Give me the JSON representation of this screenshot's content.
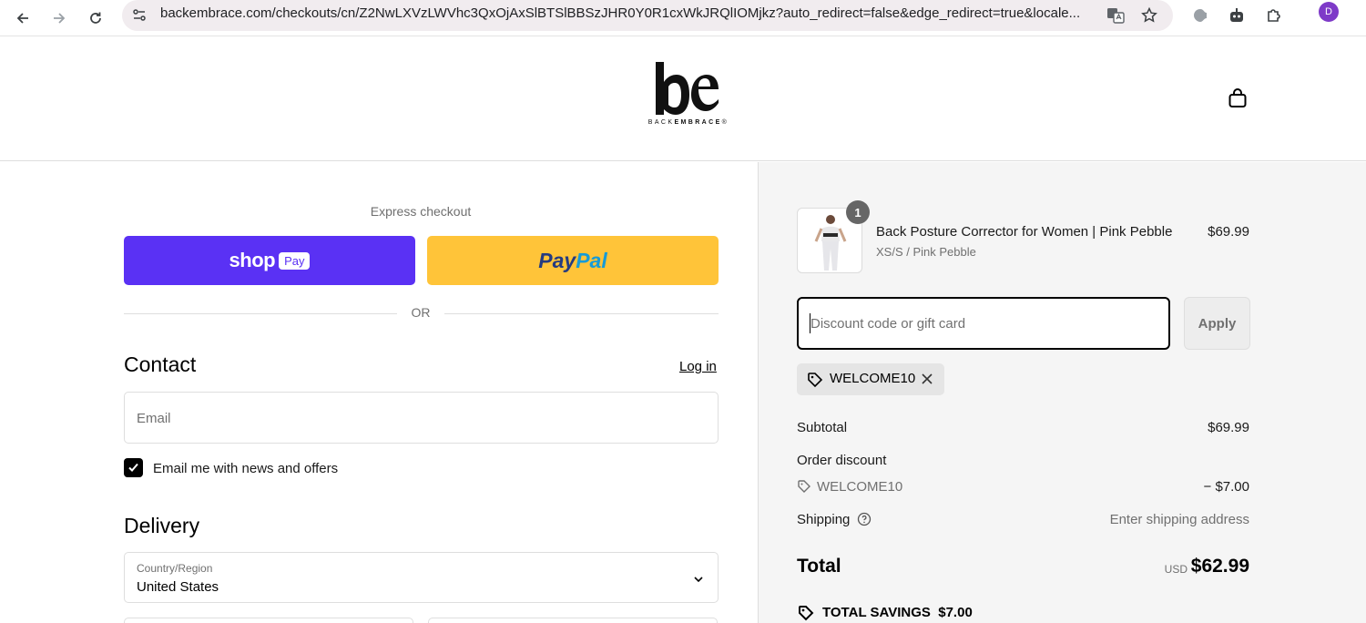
{
  "browser": {
    "url": "backembrace.com/checkouts/cn/Z2NwLXVzLWVhc3QxOjAxSlBTSlBBSzJHR0Y0R1cxWkJRQlIOMjkz?auto_redirect=false&edge_redirect=true&locale...",
    "profile_initial": "D",
    "icons": [
      "back-icon",
      "forward-icon",
      "reload-icon",
      "site-settings-icon",
      "translate-icon",
      "bookmark-star-icon",
      "extension-icon",
      "robot-extension-icon",
      "puzzle-extensions-icon"
    ]
  },
  "store": {
    "logo_mark": "be",
    "wordmark_light": "BACK",
    "wordmark_bold": "EMBRACE",
    "wordmark_reg": "®"
  },
  "checkout": {
    "express_label": "Express checkout",
    "shop_pay": {
      "shop": "shop",
      "pay": "Pay"
    },
    "paypal": {
      "pay": "Pay",
      "pal": "Pal"
    },
    "or_label": "OR",
    "contact": {
      "title": "Contact",
      "login_link": "Log in",
      "email_placeholder": "Email",
      "newsletter_label": "Email me with news and offers",
      "newsletter_checked": true
    },
    "delivery": {
      "title": "Delivery",
      "country_label": "Country/Region",
      "country_value": "United States"
    }
  },
  "summary": {
    "item": {
      "quantity": "1",
      "title": "Back Posture Corrector for Women | Pink Pebble",
      "variant": "XS/S / Pink Pebble",
      "price": "$69.99"
    },
    "discount_placeholder": "Discount code or gift card",
    "apply_label": "Apply",
    "applied_code": "WELCOME10",
    "subtotal_label": "Subtotal",
    "subtotal_value": "$69.99",
    "order_discount_label": "Order discount",
    "discount_code": "WELCOME10",
    "discount_value": "− $7.00",
    "shipping_label": "Shipping",
    "shipping_value": "Enter shipping address",
    "total_label": "Total",
    "total_currency": "USD",
    "total_value": "$62.99",
    "savings_label": "TOTAL SAVINGS",
    "savings_value": "$7.00"
  },
  "colors": {
    "shop_pay": "#5a31f4",
    "paypal_yellow": "#ffc439",
    "paypal_dark": "#253b80",
    "paypal_light": "#179bd7",
    "summary_bg": "#f5f5f5"
  }
}
